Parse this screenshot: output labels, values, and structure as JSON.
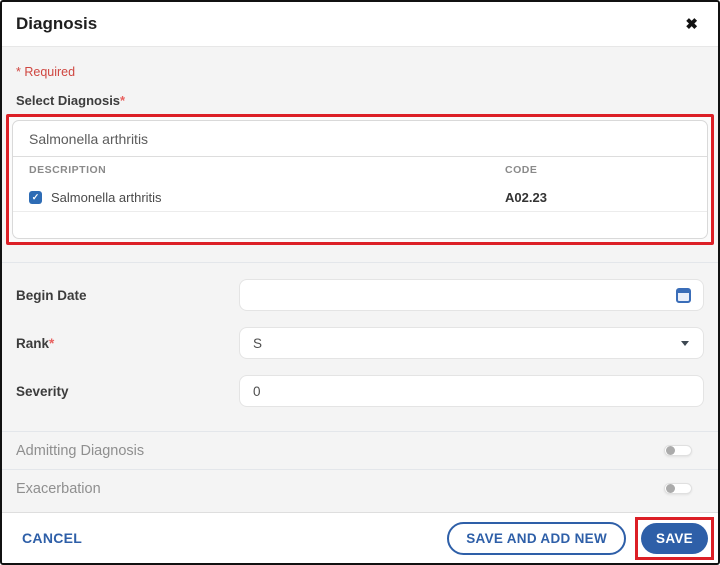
{
  "dialog": {
    "title": "Diagnosis",
    "close_icon": "✖"
  },
  "body": {
    "required_note": "* Required",
    "select_diagnosis": {
      "label": "Select Diagnosis",
      "required_mark": "*",
      "search_value": "Salmonella arthritis",
      "columns": {
        "description": "DESCRIPTION",
        "code": "CODE"
      },
      "rows": [
        {
          "description": "Salmonella arthritis",
          "code": "A02.23",
          "checked": true
        }
      ]
    },
    "fields": {
      "begin_date": {
        "label": "Begin Date",
        "value": ""
      },
      "rank": {
        "label": "Rank",
        "required_mark": "*",
        "value": "S"
      },
      "severity": {
        "label": "Severity",
        "value": "0"
      }
    },
    "toggles": {
      "admitting": {
        "label": "Admitting Diagnosis",
        "state": "off"
      },
      "exacerbation": {
        "label": "Exacerbation",
        "state": "off"
      }
    }
  },
  "footer": {
    "cancel": "CANCEL",
    "save_and_add_new": "SAVE AND ADD NEW",
    "save": "SAVE"
  },
  "colors": {
    "accent_blue": "#2e5fa8",
    "highlight_red": "#dc1f26",
    "required_red": "#cf4640"
  }
}
